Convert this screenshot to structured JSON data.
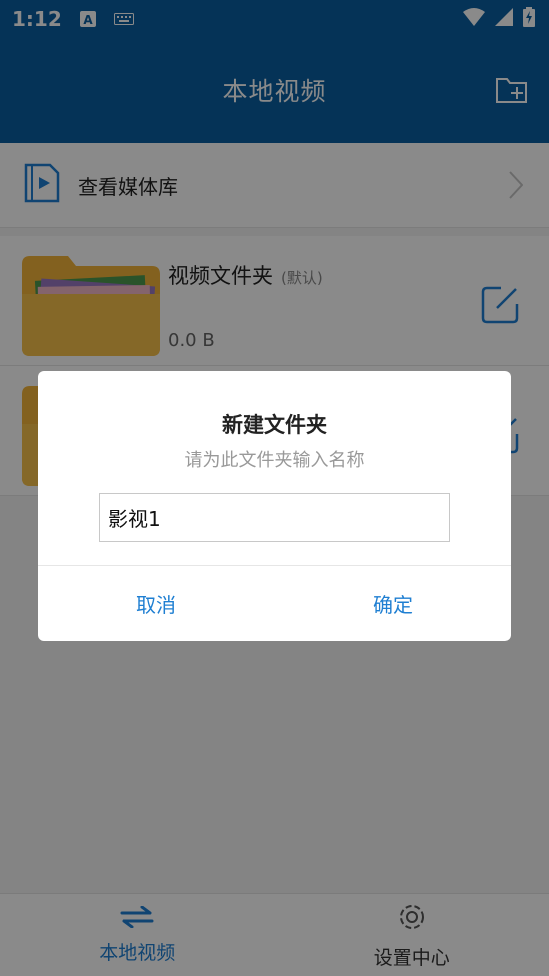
{
  "status_bar": {
    "time": "1:12",
    "icons": [
      "a-notification-icon",
      "keyboard-icon",
      "wifi-icon",
      "signal-icon",
      "battery-charging-icon"
    ]
  },
  "app_bar": {
    "title": "本地视频",
    "action_icon": "new-folder-icon"
  },
  "media_library": {
    "label": "查看媒体库"
  },
  "folders": [
    {
      "name": "视频文件夹",
      "tag": "(默认)",
      "size": "0.0 B"
    },
    {
      "name": "",
      "tag": "",
      "size": ""
    }
  ],
  "dialog": {
    "title": "新建文件夹",
    "subtitle": "请为此文件夹输入名称",
    "input_value": "影视1",
    "cancel_label": "取消",
    "confirm_label": "确定"
  },
  "bottom_nav": {
    "tabs": [
      {
        "label": "本地视频",
        "icon": "switch-arrows-icon",
        "active": true
      },
      {
        "label": "设置中心",
        "icon": "gear-icon",
        "active": false
      }
    ]
  },
  "colors": {
    "primary": "#0a5fa1",
    "accent": "#1f7fd2",
    "folder": "#f2b33a"
  }
}
